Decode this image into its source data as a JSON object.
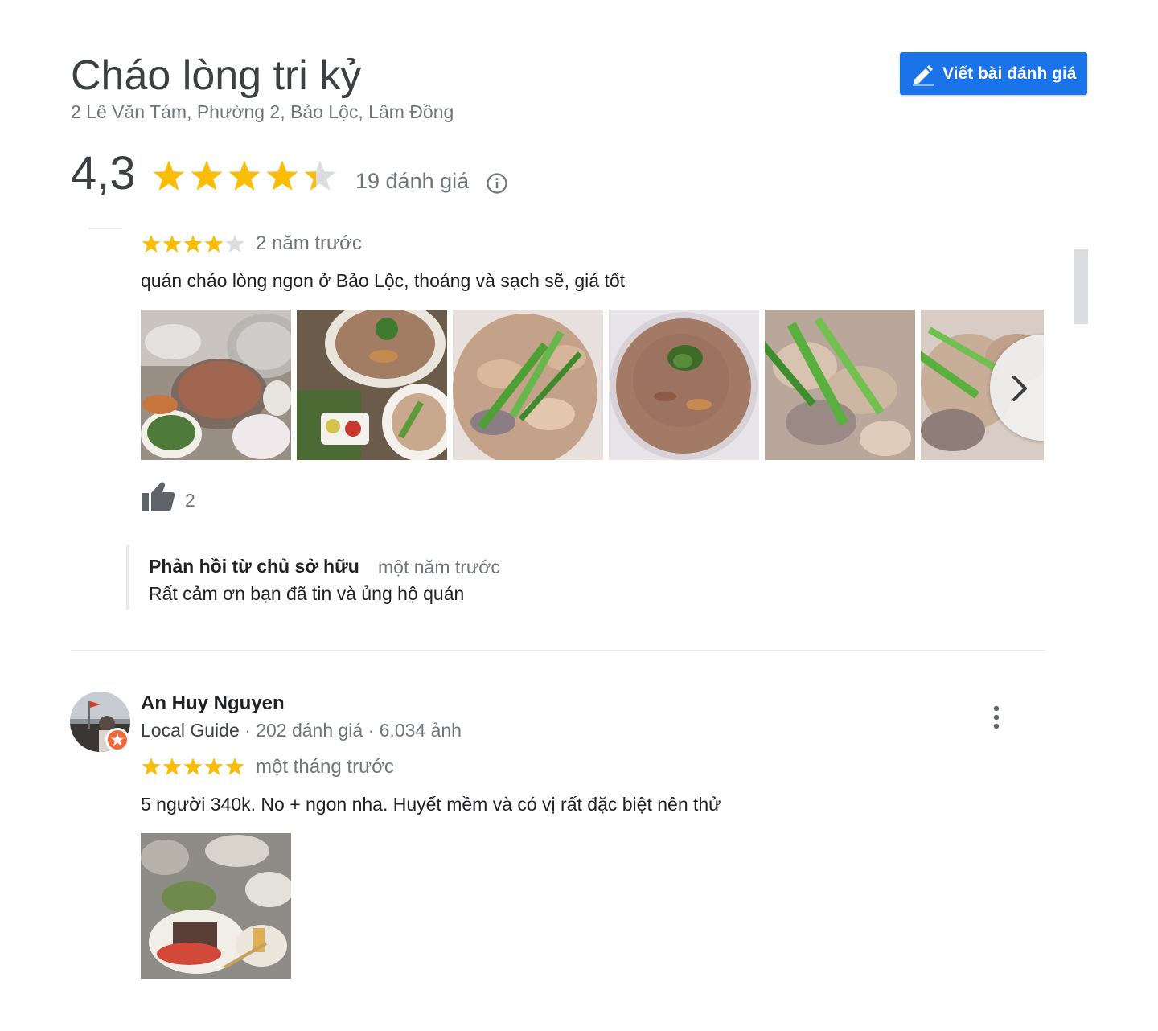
{
  "place": {
    "name": "Cháo lòng tri kỷ",
    "address": "2 Lê Văn Tám, Phường 2, Bảo Lộc, Lâm Đồng",
    "rating": "4,3",
    "rating_value": 4.3,
    "review_count": "19 đánh giá"
  },
  "write_review": {
    "label": "Viết bài đánh giá",
    "icon": "pencil-icon",
    "color": "#1a73e8"
  },
  "colors": {
    "star": "#fbbc04",
    "star_empty": "#dadce0",
    "text_secondary": "#70757a"
  },
  "reviews": [
    {
      "stars": 4,
      "time": "2 năm trước",
      "text": "quán cháo lòng ngon ở Bảo Lộc, thoáng và sạch sẽ, giá tốt",
      "photo_count": 6,
      "likes": "2",
      "owner_response": {
        "label": "Phản hồi từ chủ sở hữu",
        "time": "một năm trước",
        "text": "Rất cảm ơn bạn đã tin và ủng hộ quán"
      }
    },
    {
      "reviewer": "An Huy Nguyen",
      "local_guide": "Local Guide",
      "meta": " · 202 đánh giá · 6.034 ảnh",
      "stars": 5,
      "time": "một tháng trước",
      "text": "5 người 340k. No + ngon nha. Huyết mềm và có vị rất đặc biệt nên thử",
      "photo_count": 1
    }
  ]
}
